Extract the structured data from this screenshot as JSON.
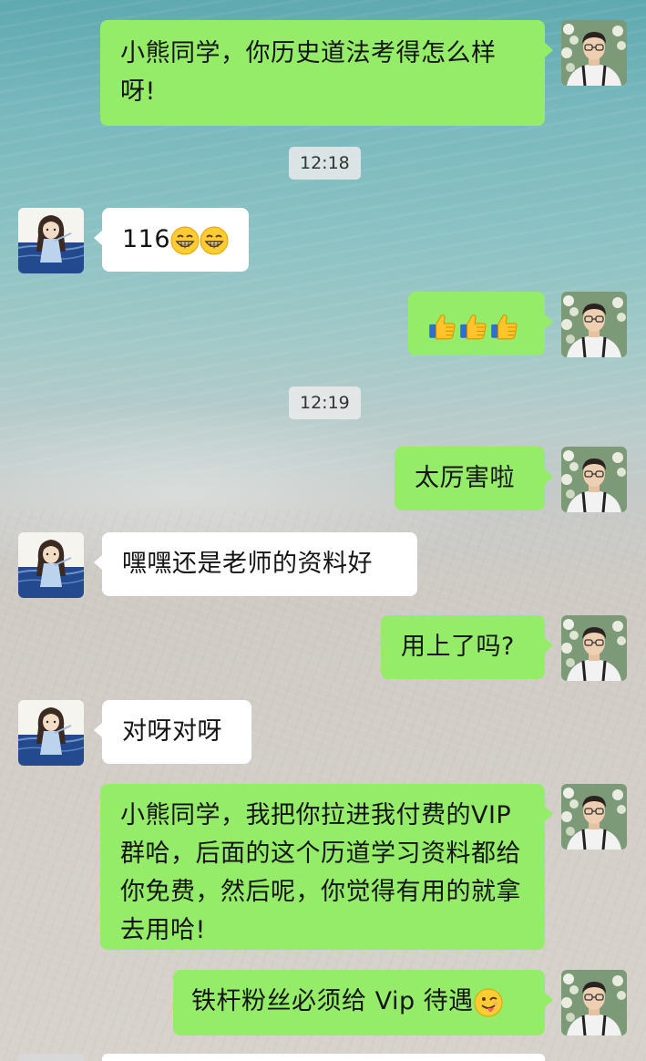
{
  "chat": {
    "messages": [
      {
        "side": "out",
        "text": "小熊同学，你历史道法考得怎么样呀!"
      },
      {
        "side": "time",
        "text": "12:18"
      },
      {
        "side": "in",
        "text": "116",
        "emoji": [
          "grin-emoji",
          "grin-emoji"
        ]
      },
      {
        "side": "out",
        "text": "",
        "emoji": [
          "thumbs-up-emoji",
          "thumbs-up-emoji",
          "thumbs-up-emoji"
        ]
      },
      {
        "side": "time",
        "text": "12:19"
      },
      {
        "side": "out",
        "text": "太厉害啦"
      },
      {
        "side": "in",
        "text": "嘿嘿还是老师的资料好"
      },
      {
        "side": "out",
        "text": "用上了吗?"
      },
      {
        "side": "in",
        "text": "对呀对呀"
      },
      {
        "side": "out",
        "text": "小熊同学，我把你拉进我付费的VIP群哈，后面的这个历道学习资料都给你免费，然后呢，你觉得有用的就拿去用哈!"
      },
      {
        "side": "out",
        "text": "铁杆粉丝必须给 Vip 待遇",
        "emoji": [
          "wink-tongue-emoji"
        ]
      }
    ]
  },
  "colors": {
    "outgoing_bubble": "#95ec69",
    "incoming_bubble": "#ffffff",
    "timestamp_bg": "#ebebeb"
  }
}
